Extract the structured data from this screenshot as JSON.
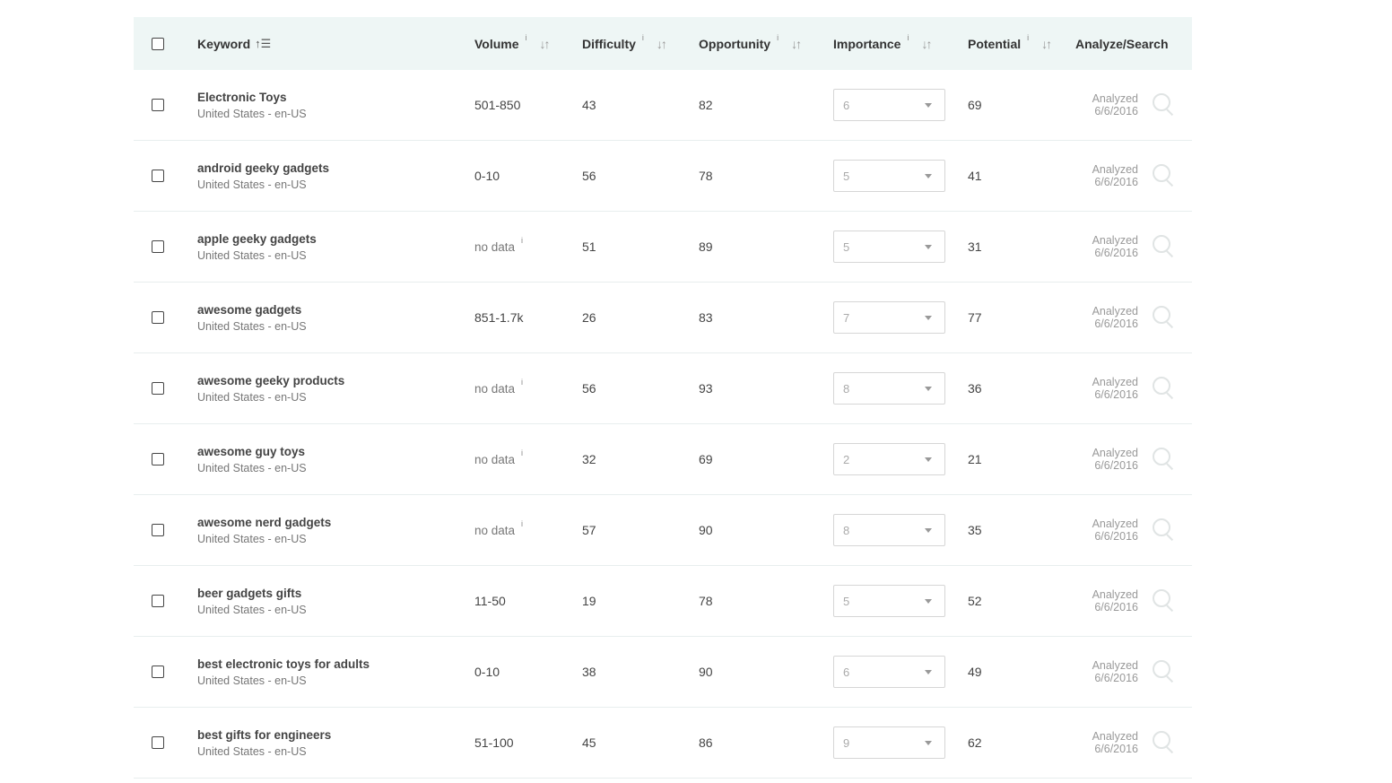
{
  "header": {
    "keyword": "Keyword",
    "keyword_sort_icon": "sort-ascending-icon",
    "volume": "Volume",
    "difficulty": "Difficulty",
    "opportunity": "Opportunity",
    "importance": "Importance",
    "potential": "Potential",
    "analyze": "Analyze/Search",
    "info_glyph": "i",
    "sort_glyph": "↓↑"
  },
  "rows": [
    {
      "keyword": "Electronic Toys",
      "locale": "United States - en-US",
      "volume": "501-850",
      "difficulty": "43",
      "opportunity": "82",
      "importance": "6",
      "potential": "69",
      "analyzed_label": "Analyzed",
      "analyzed_date": "6/6/2016"
    },
    {
      "keyword": "android geeky gadgets",
      "locale": "United States - en-US",
      "volume": "0-10",
      "difficulty": "56",
      "opportunity": "78",
      "importance": "5",
      "potential": "41",
      "analyzed_label": "Analyzed",
      "analyzed_date": "6/6/2016"
    },
    {
      "keyword": "apple geeky gadgets",
      "locale": "United States - en-US",
      "volume": "no data",
      "difficulty": "51",
      "opportunity": "89",
      "importance": "5",
      "potential": "31",
      "analyzed_label": "Analyzed",
      "analyzed_date": "6/6/2016"
    },
    {
      "keyword": "awesome gadgets",
      "locale": "United States - en-US",
      "volume": "851-1.7k",
      "difficulty": "26",
      "opportunity": "83",
      "importance": "7",
      "potential": "77",
      "analyzed_label": "Analyzed",
      "analyzed_date": "6/6/2016"
    },
    {
      "keyword": "awesome geeky products",
      "locale": "United States - en-US",
      "volume": "no data",
      "difficulty": "56",
      "opportunity": "93",
      "importance": "8",
      "potential": "36",
      "analyzed_label": "Analyzed",
      "analyzed_date": "6/6/2016"
    },
    {
      "keyword": "awesome guy toys",
      "locale": "United States - en-US",
      "volume": "no data",
      "difficulty": "32",
      "opportunity": "69",
      "importance": "2",
      "potential": "21",
      "analyzed_label": "Analyzed",
      "analyzed_date": "6/6/2016"
    },
    {
      "keyword": "awesome nerd gadgets",
      "locale": "United States - en-US",
      "volume": "no data",
      "difficulty": "57",
      "opportunity": "90",
      "importance": "8",
      "potential": "35",
      "analyzed_label": "Analyzed",
      "analyzed_date": "6/6/2016"
    },
    {
      "keyword": "beer gadgets gifts",
      "locale": "United States - en-US",
      "volume": "11-50",
      "difficulty": "19",
      "opportunity": "78",
      "importance": "5",
      "potential": "52",
      "analyzed_label": "Analyzed",
      "analyzed_date": "6/6/2016"
    },
    {
      "keyword": "best electronic toys for adults",
      "locale": "United States - en-US",
      "volume": "0-10",
      "difficulty": "38",
      "opportunity": "90",
      "importance": "6",
      "potential": "49",
      "analyzed_label": "Analyzed",
      "analyzed_date": "6/6/2016"
    },
    {
      "keyword": "best gifts for engineers",
      "locale": "United States - en-US",
      "volume": "51-100",
      "difficulty": "45",
      "opportunity": "86",
      "importance": "9",
      "potential": "62",
      "analyzed_label": "Analyzed",
      "analyzed_date": "6/6/2016"
    }
  ]
}
